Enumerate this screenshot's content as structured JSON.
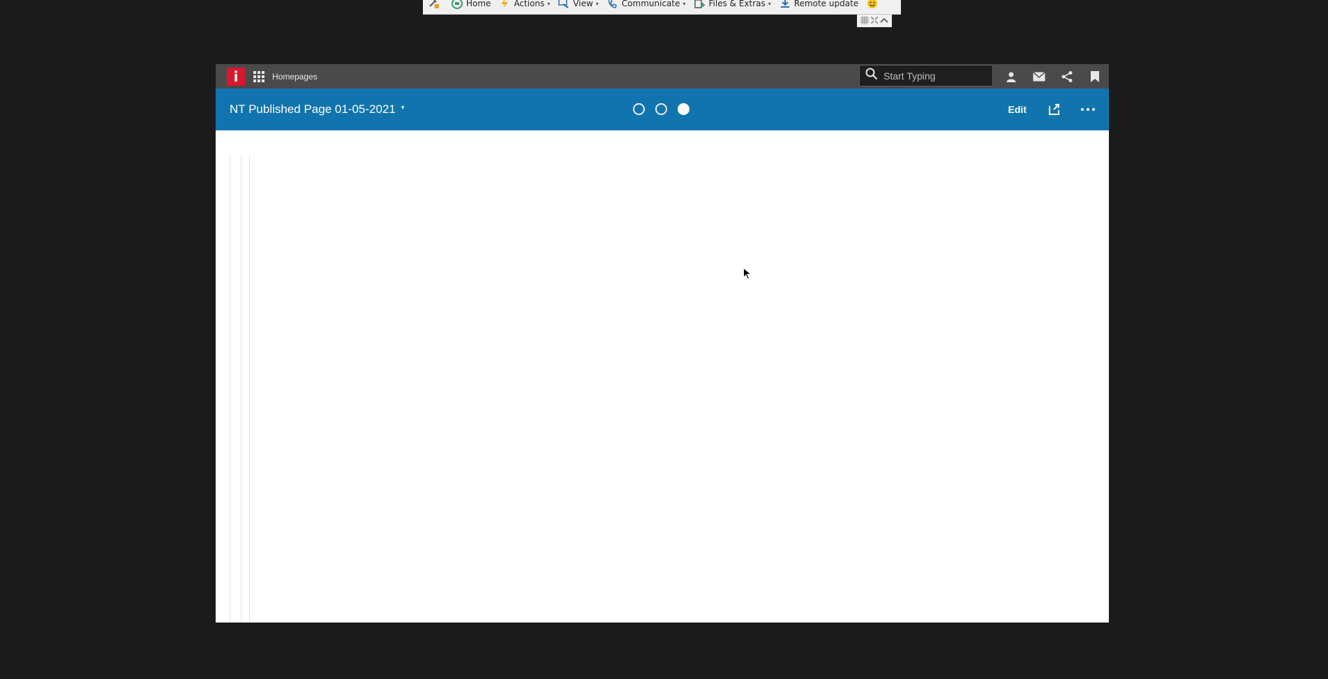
{
  "remote_toolbar": {
    "items": [
      {
        "label": "Home",
        "icon": "home-icon",
        "has_menu": false
      },
      {
        "label": "Actions",
        "icon": "lightning-icon",
        "has_menu": true
      },
      {
        "label": "View",
        "icon": "view-icon",
        "has_menu": true
      },
      {
        "label": "Communicate",
        "icon": "phone-icon",
        "has_menu": true
      },
      {
        "label": "Files & Extras",
        "icon": "files-icon",
        "has_menu": true
      },
      {
        "label": "Remote update",
        "icon": "download-icon",
        "has_menu": false
      }
    ],
    "caret": "▾"
  },
  "app": {
    "logo_letter": "i",
    "breadcrumb": "Homepages",
    "search": {
      "placeholder": "Start Typing",
      "value": ""
    }
  },
  "page": {
    "title": "NT Published Page 01-05-2021",
    "title_caret": "▾",
    "steps": [
      {
        "active": false
      },
      {
        "active": false
      },
      {
        "active": true
      }
    ],
    "edit_label": "Edit"
  },
  "colors": {
    "topbar": "#4a4a4a",
    "titlebar": "#1174ae",
    "logo": "#d9182d",
    "background": "#1b1b1b"
  }
}
